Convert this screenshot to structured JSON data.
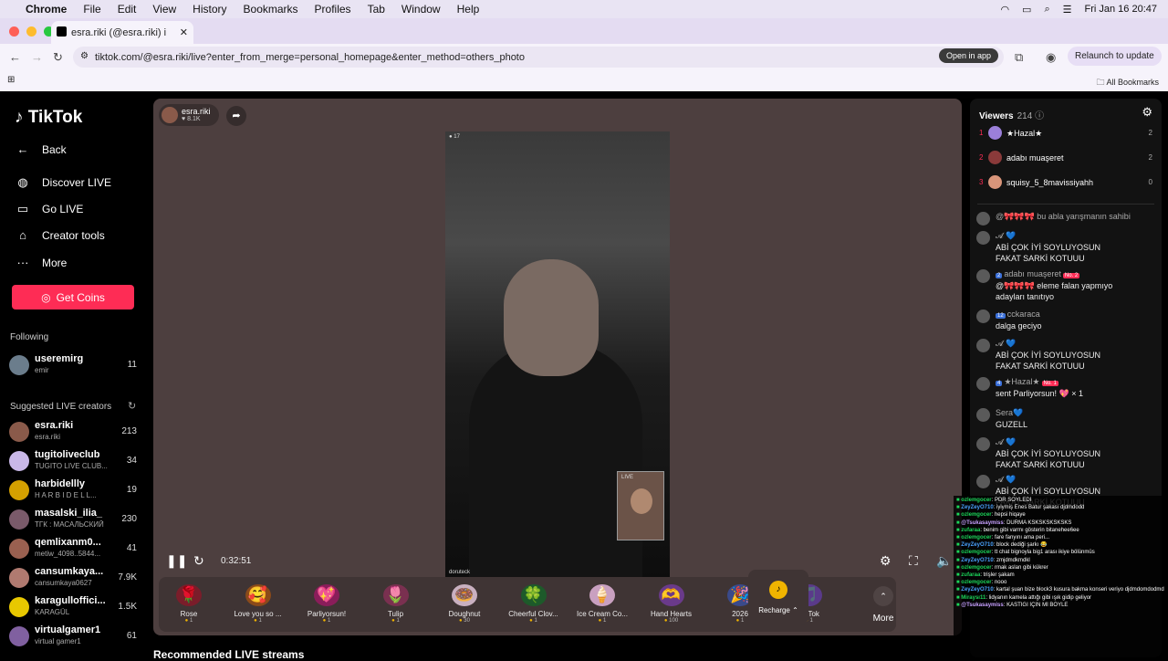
{
  "menubar": {
    "app": "Chrome",
    "items": [
      "File",
      "Edit",
      "View",
      "History",
      "Bookmarks",
      "Profiles",
      "Tab",
      "Window",
      "Help"
    ],
    "datetime": "Fri Jan 16  20:47"
  },
  "browser": {
    "tab_title": "esra.riki (@esra.riki) is LIV",
    "url": "tiktok.com/@esra.riki/live?enter_from_merge=personal_homepage&enter_method=others_photo",
    "open_in_app": "Open in app",
    "relaunch": "Relaunch to update",
    "all_bookmarks": "All Bookmarks"
  },
  "sidebar": {
    "logo": "TikTok",
    "back": "Back",
    "nav": [
      "Discover LIVE",
      "Go LIVE",
      "Creator tools",
      "More"
    ],
    "get_coins": "Get Coins",
    "following_title": "Following",
    "following": [
      {
        "name": "useremirg",
        "sub": "emir",
        "count": "11",
        "color": "#6b7d8c"
      }
    ],
    "suggested_title": "Suggested LIVE creators",
    "suggested": [
      {
        "name": "esra.riki",
        "sub": "esra.riki",
        "count": "213",
        "color": "#8a5a4a"
      },
      {
        "name": "tugitoliveclub",
        "sub": "TUGITO LIVE CLUB...",
        "count": "34",
        "color": "#c9b8e8"
      },
      {
        "name": "harbidellly",
        "sub": "H A R B I D E L L...",
        "count": "19",
        "color": "#d4a000"
      },
      {
        "name": "masalski_ilia_",
        "sub": "ТГК : МАСАЛЬСКИЙ",
        "count": "230",
        "color": "#7a5a6a"
      },
      {
        "name": "qemlixanm0...",
        "sub": "metiw_4098..5844...",
        "count": "41",
        "color": "#9a6050"
      },
      {
        "name": "cansumkaya...",
        "sub": "cansumkaya0627",
        "count": "7.9K",
        "color": "#b07a70"
      },
      {
        "name": "karagulloffici...",
        "sub": "KARAGÜL",
        "count": "1.5K",
        "color": "#e8c800"
      },
      {
        "name": "virtualgamer1",
        "sub": "virtual gamer1",
        "count": "61",
        "color": "#8060a0"
      }
    ]
  },
  "player": {
    "host_name": "esra.riki",
    "host_likes": "8.1K",
    "elapsed": "0:32:51",
    "video_tag": "doruteck",
    "pip_tag": "LIVE"
  },
  "gifts": [
    {
      "name": "Rose",
      "price": "1",
      "icon": "🌹"
    },
    {
      "name": "Love you so ...",
      "price": "1",
      "icon": "🥰"
    },
    {
      "name": "Parliyorsun!",
      "price": "1",
      "icon": "💖"
    },
    {
      "name": "Tulip",
      "price": "1",
      "icon": "🌷"
    },
    {
      "name": "Doughnut",
      "price": "30",
      "icon": "🍩"
    },
    {
      "name": "Cheerful Clov...",
      "price": "1",
      "icon": "🍀"
    },
    {
      "name": "Ice Cream Co...",
      "price": "1",
      "icon": "🍦"
    },
    {
      "name": "Hand Hearts",
      "price": "100",
      "icon": "🫶"
    },
    {
      "name": "2026",
      "price": "1",
      "icon": "🎉"
    },
    {
      "name": "TikTok",
      "price": "1",
      "icon": "🎵"
    }
  ],
  "gift_more": "More",
  "recharge": "Recharge",
  "recommended": "Recommended LIVE streams",
  "viewers": {
    "title": "Viewers",
    "count": "214",
    "list": [
      {
        "rank": "1",
        "name": "★Hazal★",
        "count": "2",
        "color": "#9b7fd9"
      },
      {
        "rank": "2",
        "name": "adabı muaşeret",
        "count": "2",
        "color": "#8a3a3a"
      },
      {
        "rank": "3",
        "name": "squisy_5_8mavissiyahh",
        "count": "0",
        "color": "#d9957a"
      }
    ]
  },
  "chat": [
    {
      "who": "@🎀🎀🎀 bu abla yarışmanın sahibi",
      "badge": "",
      "rank": "",
      "text": ""
    },
    {
      "who": "𝓐 💙",
      "badge": "",
      "rank": "",
      "text": "ABİ ÇOK İYİ SOYLUYOSUN FAKAT SARKİ KOTUUU"
    },
    {
      "who": "adabı muaşeret",
      "badge": "2",
      "rank": "No. 2",
      "text": "@🎀🎀🎀 eleme falan yapmıyo adayları tanıtıyo"
    },
    {
      "who": "cckaraca",
      "badge": "12",
      "rank": "",
      "text": "dalga geciyo"
    },
    {
      "who": "𝓐 💙",
      "badge": "",
      "rank": "",
      "text": "ABİ ÇOK İYİ SOYLUYOSUN FAKAT SARKİ KOTUUU"
    },
    {
      "who": "★Hazal★",
      "badge": "4",
      "rank": "No. 1",
      "text": "sent Parliyorsun! 💖 × 1"
    },
    {
      "who": "Sera💙",
      "badge": "",
      "rank": "",
      "text": "GUZELL"
    },
    {
      "who": "𝓐 💙",
      "badge": "",
      "rank": "",
      "text": "ABİ ÇOK İYİ SOYLUYOSUN FAKAT SARKİ KOTUUU"
    },
    {
      "who": "𝓐 💙",
      "badge": "",
      "rank": "",
      "text": "ABİ ÇOK İYİ SOYLUYOSUN FAKAT SARKİ KOTUUU"
    }
  ],
  "overlay_chat": [
    {
      "user": "ozlemgocer",
      "text": ": PDR SOYLEDİ",
      "c": "g"
    },
    {
      "user": "ZeyZeyO710",
      "text": ": iyiymiş Enes Batur şakası djdmdodd",
      "c": "b"
    },
    {
      "user": "ozlemgocer",
      "text": ": hepsi hiqaye",
      "c": "g"
    },
    {
      "user": "@Tsukasaymiss",
      "text": ": DURMA KSKSKSKSKSKS",
      "c": "p"
    },
    {
      "user": "zufaraa",
      "text": ": benim gibi varmı gösterin bitanehee6ee",
      "c": "g"
    },
    {
      "user": "ozlemgocer",
      "text": ": fare fanyını ama peri...",
      "c": "g"
    },
    {
      "user": "ZeyZeyO710",
      "text": ": block dediği şarkı 😂",
      "c": "b"
    },
    {
      "user": "ozlemgocer",
      "text": ": tt chat bignoyla big1 arası ikiye bölünmüs",
      "c": "g"
    },
    {
      "user": "ZeyZeyO710",
      "text": ": zmjdmdkmdkl",
      "c": "b"
    },
    {
      "user": "ozlemgocer",
      "text": ": rmak aslan gibi kükrer",
      "c": "g"
    },
    {
      "user": "zufaraa",
      "text": ": trişler şakam",
      "c": "g"
    },
    {
      "user": "ozlemgocer",
      "text": ": nooo",
      "c": "g"
    },
    {
      "user": "ZeyZeyO710",
      "text": ": kartal şuan bize block3 kusura bakma konseri veriyo djdmdomdodmd",
      "c": "b"
    },
    {
      "user": "Miraysı11",
      "text": ": lidyanın kamela attığı gibi ışık gidip geliyor",
      "c": "g"
    },
    {
      "user": "@Tsukasaymiss",
      "text": ": KASTIĞI İÇİN Mİ BÖYLE",
      "c": "p"
    }
  ]
}
